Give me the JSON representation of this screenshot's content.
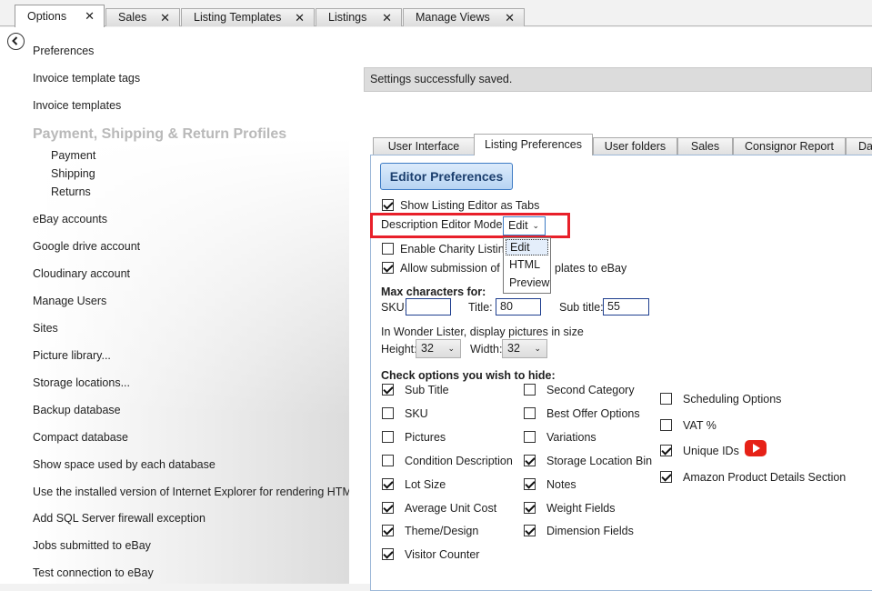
{
  "top_tabs": [
    {
      "label": "Options",
      "close": "✕"
    },
    {
      "label": "Sales",
      "close": "✕"
    },
    {
      "label": "Listing Templates",
      "close": "✕"
    },
    {
      "label": "Listings",
      "close": "✕"
    },
    {
      "label": "Manage Views",
      "close": "✕"
    }
  ],
  "sidebar": {
    "items_top": [
      "Preferences",
      "Invoice template tags",
      "Invoice templates"
    ],
    "section_header": "Payment, Shipping & Return Profiles",
    "sub_items": [
      "Payment",
      "Shipping",
      "Returns"
    ],
    "items": [
      "eBay accounts",
      "Google drive account",
      "Cloudinary account",
      "Manage Users",
      "Sites",
      "Picture library...",
      "Storage locations...",
      "Backup database",
      "Compact database",
      "Show space used by each database",
      "Use the installed version of Internet Explorer for rendering HTML",
      "Add SQL Server firewall exception",
      "Jobs submitted to eBay",
      "Test connection to eBay"
    ]
  },
  "status": "Settings successfully saved.",
  "inner_tabs": [
    "User Interface",
    "Listing Preferences",
    "User folders",
    "Sales",
    "Consignor Report",
    "Da"
  ],
  "editor": {
    "header": "Editor Preferences",
    "show_tabs_label": "Show Listing Editor as Tabs",
    "mode_label": "Description Editor Mode",
    "mode_value": "Edit",
    "mode_options": [
      "Edit",
      "HTML",
      "Preview"
    ],
    "charity_label": "Enable Charity Listing",
    "allow_label_a": "Allow submission of li",
    "allow_label_b": "plates to eBay",
    "max_chars_label": "Max characters for:",
    "sku_label": "SKU:",
    "sku_value": "",
    "title_label": "Title:",
    "title_value": "80",
    "subtitle_label": "Sub title:",
    "subtitle_value": "55",
    "pictures_label": "In Wonder Lister, display pictures in size",
    "height_label": "Height:",
    "height_value": "32",
    "width_label": "Width:",
    "width_value": "32",
    "hide_label": "Check options you wish to hide:"
  },
  "hide_options": {
    "col1": [
      {
        "label": "Sub Title",
        "checked": true
      },
      {
        "label": "SKU",
        "checked": false
      },
      {
        "label": "Pictures",
        "checked": false
      },
      {
        "label": "Condition Description",
        "checked": false
      },
      {
        "label": "Lot Size",
        "checked": true
      },
      {
        "label": "Average Unit Cost",
        "checked": true
      },
      {
        "label": "Theme/Design",
        "checked": true
      },
      {
        "label": "Visitor Counter",
        "checked": true
      }
    ],
    "col2": [
      {
        "label": "Second Category",
        "checked": false
      },
      {
        "label": "Best Offer Options",
        "checked": false
      },
      {
        "label": "Variations",
        "checked": false
      },
      {
        "label": "Storage Location Bin",
        "checked": true
      },
      {
        "label": "Notes",
        "checked": true
      },
      {
        "label": "Weight Fields",
        "checked": true
      },
      {
        "label": "Dimension Fields",
        "checked": true
      }
    ],
    "col3": [
      {
        "label": "Scheduling Options",
        "checked": false
      },
      {
        "label": "VAT %",
        "checked": false
      },
      {
        "label": "Unique IDs",
        "checked": true
      },
      {
        "label": "Amazon Product Details Section",
        "checked": true
      }
    ]
  },
  "icons": {
    "back": "back-arrow-icon",
    "youtube": "youtube-icon"
  },
  "colors": {
    "highlight": "#e8202a",
    "header_blue": "#1c3f6e"
  }
}
